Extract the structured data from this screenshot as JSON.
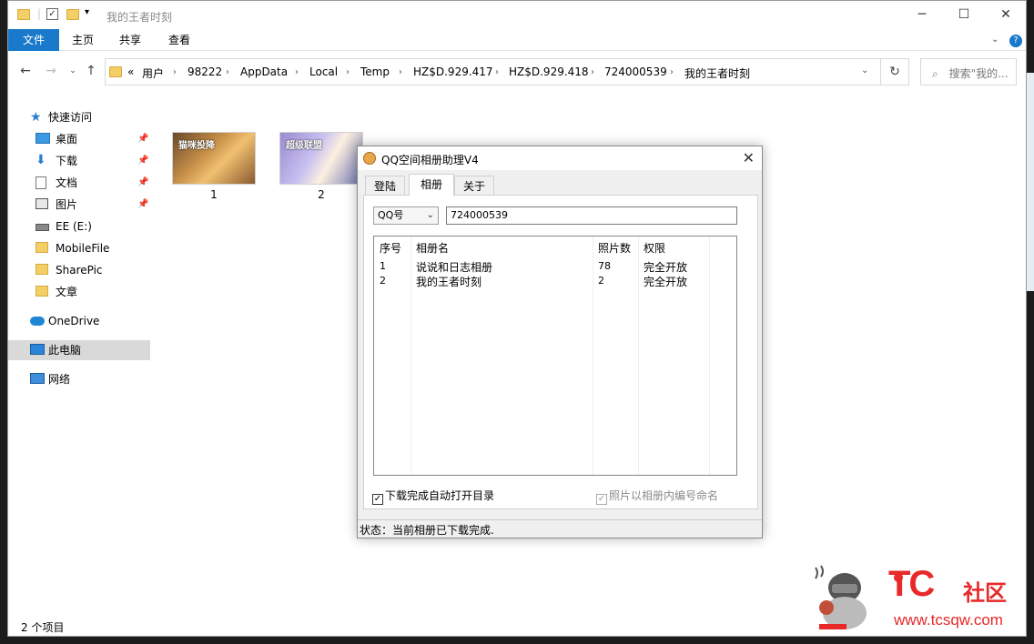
{
  "window": {
    "title": "我的王者时刻",
    "controls": [
      "─",
      "☐",
      "✕"
    ]
  },
  "ribbon": {
    "file_label": "文件",
    "tabs": [
      "主页",
      "共享",
      "查看"
    ]
  },
  "address": {
    "prefix": "«",
    "crumbs": [
      "用户",
      "98222",
      "AppData",
      "Local",
      "Temp",
      "HZ$D.929.417",
      "HZ$D.929.418",
      "724000539",
      "我的王者时刻"
    ],
    "search_placeholder": "搜索\"我的..."
  },
  "nav": {
    "quick_access": "快速访问",
    "items": [
      {
        "label": "桌面",
        "pinned": true
      },
      {
        "label": "下载",
        "pinned": true
      },
      {
        "label": "文档",
        "pinned": true
      },
      {
        "label": "图片",
        "pinned": true
      },
      {
        "label": "EE (E:)"
      },
      {
        "label": "MobileFile"
      },
      {
        "label": "SharePic"
      },
      {
        "label": "文章"
      }
    ],
    "onedrive": "OneDrive",
    "this_pc": "此电脑",
    "network": "网络"
  },
  "files": [
    {
      "name": "1",
      "thumb_text": "猫咪投降"
    },
    {
      "name": "2",
      "thumb_text": "超级联盟"
    }
  ],
  "statusbar": {
    "text": "2 个项目"
  },
  "dialog": {
    "title": "QQ空间相册助理V4",
    "tabs": [
      "登陆",
      "相册",
      "关于"
    ],
    "active_tab": "相册",
    "id_type": "QQ号",
    "qq_number": "724000539",
    "columns": [
      "序号",
      "相册名",
      "照片数",
      "权限"
    ],
    "rows": [
      {
        "index": "1",
        "name": "说说和日志相册",
        "count": "78",
        "permission": "完全开放"
      },
      {
        "index": "2",
        "name": "我的王者时刻",
        "count": "2",
        "permission": "完全开放"
      }
    ],
    "auto_open_label": "下载完成自动打开目录",
    "auto_open_checked": true,
    "rename_label": "照片以相册内编号命名",
    "rename_checked": true,
    "status": "状态：当前相册已下载完成."
  },
  "watermark": {
    "brand": "TC",
    "suffix": "社区",
    "url": "www.tcsqw.com"
  }
}
